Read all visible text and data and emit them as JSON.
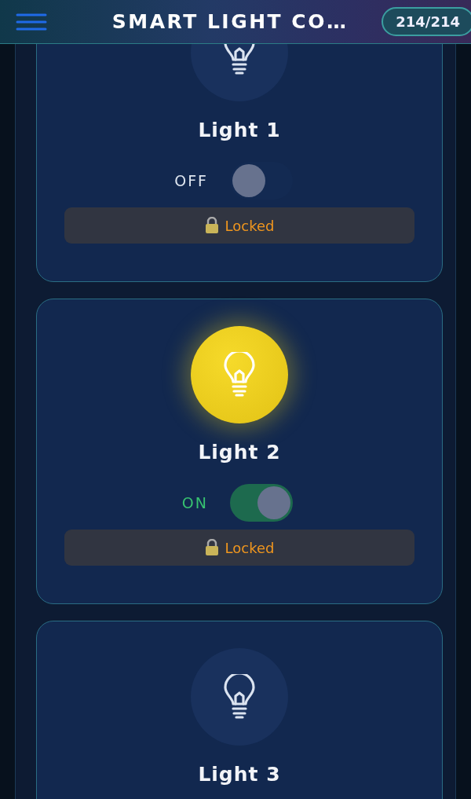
{
  "header": {
    "title": "SMART LIGHT CO…",
    "counter": "214/214"
  },
  "lights": [
    {
      "name": "Light 1",
      "on": false,
      "state_label": "OFF",
      "lock_label": "Locked"
    },
    {
      "name": "Light 2",
      "on": true,
      "state_label": "ON",
      "lock_label": "Locked"
    },
    {
      "name": "Light 3",
      "on": false
    }
  ]
}
